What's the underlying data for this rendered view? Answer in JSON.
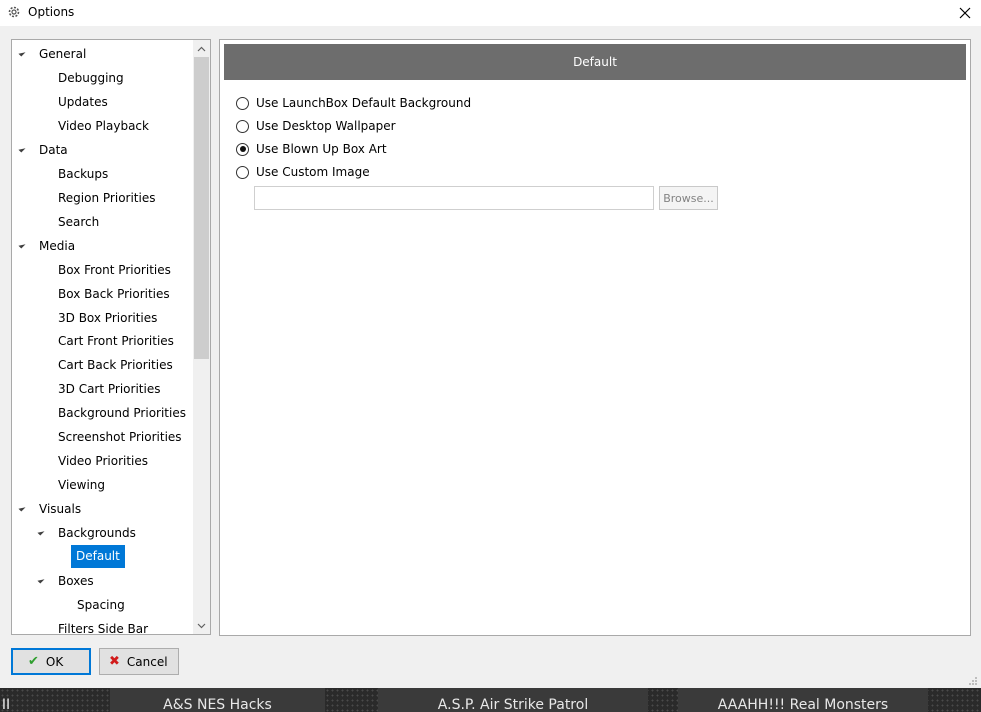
{
  "window": {
    "title": "Options"
  },
  "tree": {
    "items": [
      {
        "label": "General",
        "expanded": true
      },
      {
        "label": "Debugging"
      },
      {
        "label": "Updates"
      },
      {
        "label": "Video Playback"
      },
      {
        "label": "Data",
        "expanded": true
      },
      {
        "label": "Backups"
      },
      {
        "label": "Region Priorities"
      },
      {
        "label": "Search"
      },
      {
        "label": "Media",
        "expanded": true
      },
      {
        "label": "Box Front Priorities"
      },
      {
        "label": "Box Back Priorities"
      },
      {
        "label": "3D Box Priorities"
      },
      {
        "label": "Cart Front Priorities"
      },
      {
        "label": "Cart Back Priorities"
      },
      {
        "label": "3D Cart Priorities"
      },
      {
        "label": "Background Priorities"
      },
      {
        "label": "Screenshot Priorities"
      },
      {
        "label": "Video Priorities"
      },
      {
        "label": "Viewing"
      },
      {
        "label": "Visuals",
        "expanded": true
      },
      {
        "label": "Backgrounds",
        "expanded": true
      },
      {
        "label": "Default",
        "selected": true
      },
      {
        "label": "Boxes",
        "expanded": true
      },
      {
        "label": "Spacing"
      },
      {
        "label": "Filters Side Bar"
      }
    ]
  },
  "content": {
    "header": "Default",
    "options": [
      {
        "label": "Use LaunchBox Default Background",
        "checked": false
      },
      {
        "label": "Use Desktop Wallpaper",
        "checked": false
      },
      {
        "label": "Use Blown Up Box Art",
        "checked": true
      },
      {
        "label": "Use Custom Image",
        "checked": false
      }
    ],
    "custom_image_path": "",
    "browse_label": "Browse..."
  },
  "buttons": {
    "ok_label": "OK",
    "cancel_label": "Cancel"
  },
  "background_strip": {
    "left_text": "II",
    "tiles": [
      "A&S NES Hacks",
      "A.S.P. Air Strike Patrol",
      "AAAHH!!! Real Monsters"
    ]
  },
  "colors": {
    "selection": "#0078d7",
    "header_bg": "#6d6d6d",
    "ok_check": "#2e9e2e",
    "cancel_x": "#d11a1a"
  }
}
